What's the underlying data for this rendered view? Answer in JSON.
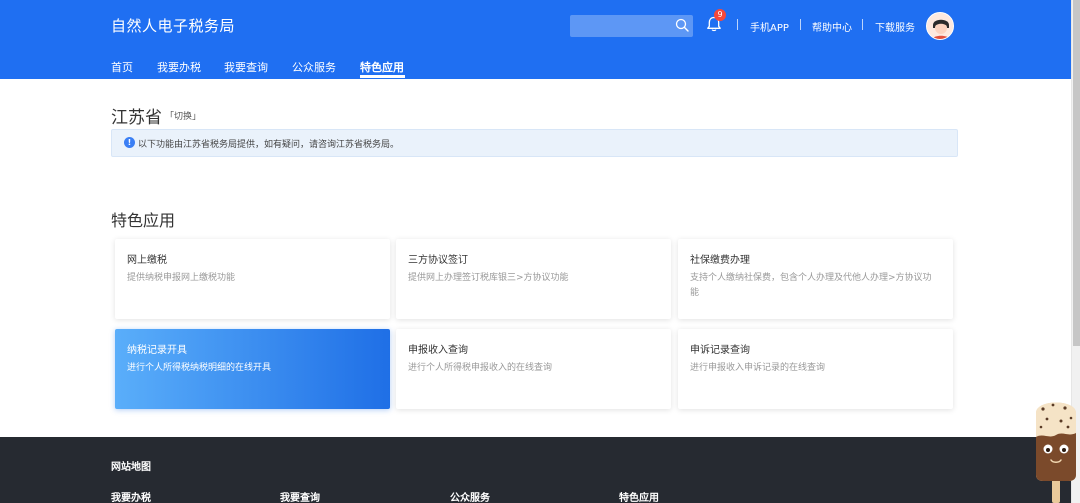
{
  "header": {
    "logo": "自然人电子税务局",
    "search_placeholder": "",
    "notification_count": "9",
    "links": [
      "手机APP",
      "帮助中心",
      "下载服务"
    ]
  },
  "nav": {
    "items": [
      "首页",
      "我要办税",
      "我要查询",
      "公众服务",
      "特色应用"
    ],
    "active": "特色应用"
  },
  "province": {
    "name": "江苏省",
    "switch_label": "「切换」",
    "notice": "以下功能由江苏省税务局提供，如有疑问，请咨询江苏省税务局。"
  },
  "section": {
    "title": "特色应用",
    "cards": [
      {
        "title": "网上缴税",
        "desc": "提供纳税申报网上缴税功能"
      },
      {
        "title": "三方协议签订",
        "desc": "提供网上办理签订税库银三>方协议功能"
      },
      {
        "title": "社保缴费办理",
        "desc": "支持个人缴纳社保费，包含个人办理及代他人办理>方协议功能"
      },
      {
        "title": "纳税记录开具",
        "desc": "进行个人所得税纳税明细的在线开具",
        "highlighted": true
      },
      {
        "title": "申报收入查询",
        "desc": "进行个人所得税申报收入的在线查询"
      },
      {
        "title": "申诉记录查询",
        "desc": "进行申报收入申诉记录的在线查询"
      }
    ]
  },
  "footer": {
    "title": "网站地图",
    "columns": [
      "我要办税",
      "我要查询",
      "公众服务",
      "特色应用"
    ]
  },
  "colors": {
    "brand_blue": "#1f6ff2",
    "footer_bg": "#262a31",
    "badge_red": "#f5483b"
  }
}
